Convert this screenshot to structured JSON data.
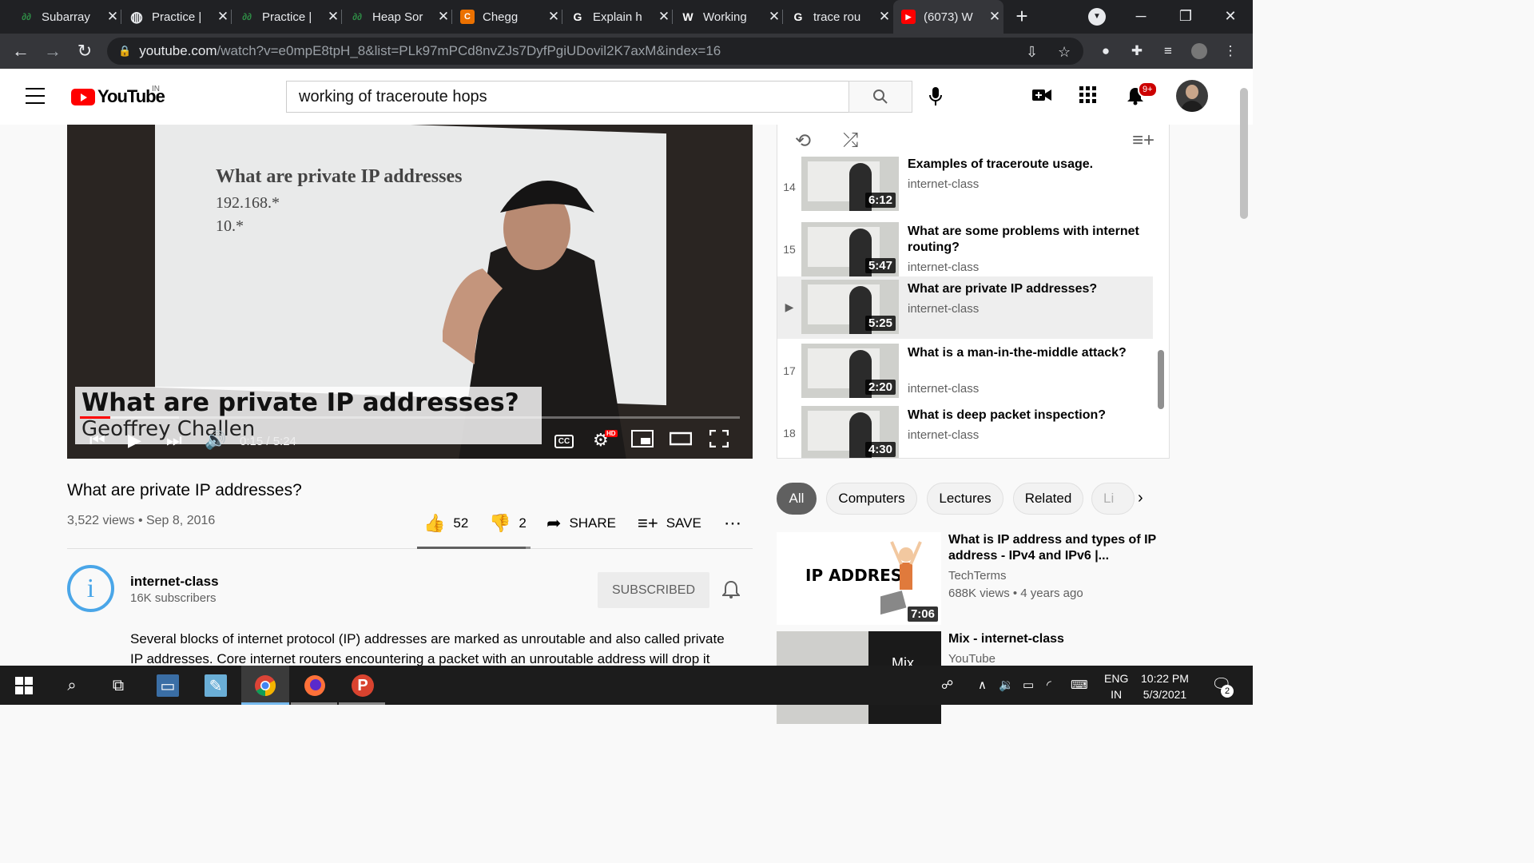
{
  "browser": {
    "tabs": [
      {
        "title": "Subarray",
        "fav": "gfg",
        "favcolor": "#2f8d46"
      },
      {
        "title": "Practice |",
        "fav": "globe",
        "favcolor": "#e8eaed"
      },
      {
        "title": "Practice |",
        "fav": "gfg",
        "favcolor": "#2f8d46"
      },
      {
        "title": "Heap Sor",
        "fav": "gfg",
        "favcolor": "#2f8d46"
      },
      {
        "title": "Chegg",
        "fav": "C",
        "favcolor": "#eb7100"
      },
      {
        "title": "Explain h",
        "fav": "G",
        "favcolor": "#ffffff"
      },
      {
        "title": "Working",
        "fav": "W",
        "favcolor": "#ffffff"
      },
      {
        "title": "trace rou",
        "fav": "G",
        "favcolor": "#ffffff"
      },
      {
        "title": "(6073) W",
        "fav": "yt",
        "favcolor": "#ff0000"
      }
    ],
    "url_domain": "youtube.com",
    "url_path": "/watch?v=e0mpE8tpH_8&list=PLk97mPCd8nvZJs7DyfPgiUDovil2K7axM&index=16"
  },
  "youtube": {
    "logo_text": "YouTube",
    "logo_country": "IN",
    "search_query": "working of traceroute hops",
    "notif_count": "9+"
  },
  "player": {
    "slide_title": "What are private IP addresses",
    "slide_line1": "192.168.*",
    "slide_line2": "10.*",
    "overlay_title": "What are private IP addresses?",
    "overlay_author": "Geoffrey Challen",
    "time": "0:15 / 5:24",
    "cc": "CC",
    "hd": "HD",
    "progress_fraction": 0.046
  },
  "video": {
    "title": "What are private IP addresses?",
    "views_date": "3,522 views • Sep 8, 2016",
    "likes": "52",
    "dislikes": "2",
    "share": "SHARE",
    "save": "SAVE"
  },
  "channel": {
    "avatar_letter": "i",
    "name": "internet-class",
    "subscribers": "16K subscribers",
    "subscribed_label": "SUBSCRIBED",
    "description": "Several blocks of internet protocol (IP) addresses are marked as unroutable and also called private IP addresses. Core internet routers encountering a packet with an unroutable address will drop it"
  },
  "playlist": {
    "items": [
      {
        "index": "14",
        "title": "Examples of traceroute usage.",
        "channel": "internet-class",
        "duration": "6:12"
      },
      {
        "index": "15",
        "title": "What are some problems with internet routing?",
        "channel": "internet-class",
        "duration": "5:47"
      },
      {
        "index": "▶",
        "title": "What are private IP addresses?",
        "channel": "internet-class",
        "duration": "5:25"
      },
      {
        "index": "17",
        "title": "What is a man-in-the-middle attack?",
        "channel": "internet-class",
        "duration": "2:20"
      },
      {
        "index": "18",
        "title": "What is deep packet inspection?",
        "channel": "internet-class",
        "duration": "4:30"
      }
    ]
  },
  "chips": [
    "All",
    "Computers",
    "Lectures",
    "Related",
    "Li"
  ],
  "recommendations": [
    {
      "title": "What is IP address and types of IP address - IPv4 and IPv6 |...",
      "channel": "TechTerms",
      "meta": "688K views • 4 years ago",
      "duration": "7:06",
      "thumb_text": "IP ADDRESS"
    },
    {
      "title": "Mix - internet-class",
      "channel": "YouTube",
      "meta": "",
      "duration": "",
      "thumb_text": "Mix"
    }
  ],
  "taskbar": {
    "lang1": "ENG",
    "lang2": "IN",
    "time": "10:22 PM",
    "date": "5/3/2021",
    "notif_count": "2"
  }
}
